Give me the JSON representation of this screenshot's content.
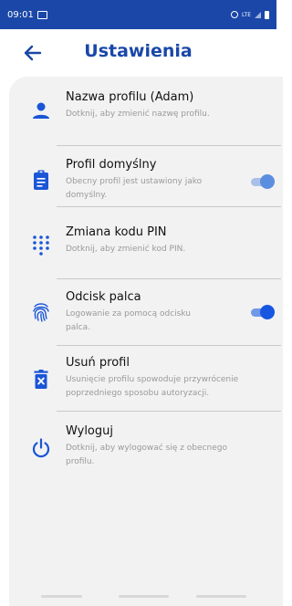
{
  "status_bar": {
    "time": "09:01",
    "network": "LTE"
  },
  "header": {
    "title": "Ustawienia"
  },
  "items": [
    {
      "name": "Nazwa profilu (Adam)",
      "desc": "Dotknij, aby zmienić nazwę profilu."
    },
    {
      "name": "Profil domyślny",
      "desc": "Obecny profil jest ustawiony jako domyślny.",
      "toggle_on": true
    },
    {
      "name": "Zmiana kodu PIN",
      "desc": "Dotknij, aby zmienić kod PIN."
    },
    {
      "name": "Odcisk palca",
      "desc": "Logowanie za pomocą odcisku palca.",
      "toggle_on": true
    },
    {
      "name": "Usuń profil",
      "desc": "Usunięcie profilu spowoduje przywrócenie poprzedniego sposobu autoryzacji."
    },
    {
      "name": "Wyloguj",
      "desc": "Dotknij, aby wylogować się z obecnego profilu."
    }
  ],
  "colors": {
    "brand": "#1a47a8",
    "icon": "#1a56d6",
    "toggle_accent": "#1756e0"
  },
  "icons": [
    "person-icon",
    "clipboard-icon",
    "dialpad-icon",
    "fingerprint-icon",
    "trash-icon",
    "power-icon"
  ]
}
